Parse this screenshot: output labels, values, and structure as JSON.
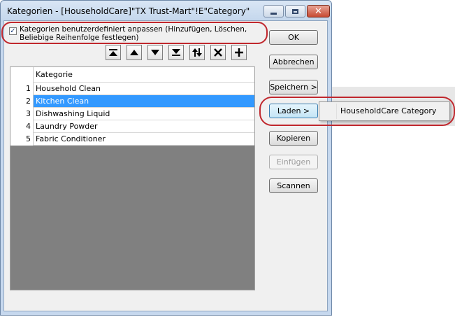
{
  "window": {
    "title": "Kategorien - [HouseholdCare]\"TX Trust-Mart\"!E\"Category\""
  },
  "customize_checkbox": {
    "checked": true,
    "label": "Kategorien benutzerdefiniert anpassen (Hinzufügen, Löschen, Beliebige Reihenfolge festlegen)"
  },
  "toolbar": [
    {
      "icon": "move-to-top-icon"
    },
    {
      "icon": "move-up-icon"
    },
    {
      "icon": "move-down-icon"
    },
    {
      "icon": "move-to-bottom-icon"
    },
    {
      "icon": "sort-icon"
    },
    {
      "icon": "delete-icon"
    },
    {
      "icon": "add-icon"
    }
  ],
  "grid": {
    "header": "Kategorie",
    "rows": [
      {
        "num": "1",
        "label": "Household Clean"
      },
      {
        "num": "2",
        "label": "Kitchen Clean"
      },
      {
        "num": "3",
        "label": "Dishwashing Liquid"
      },
      {
        "num": "4",
        "label": "Laundry Powder"
      },
      {
        "num": "5",
        "label": "Fabric Conditioner"
      }
    ],
    "selected_index": 1
  },
  "buttons": {
    "ok": "OK",
    "cancel": "Abbrechen",
    "save": "Speichern >",
    "load": "Laden >",
    "copy": "Kopieren",
    "paste": "Einfügen",
    "scan": "Scannen"
  },
  "load_menu": {
    "items": [
      "HouseholdCare Category"
    ]
  },
  "colors": {
    "selection": "#3399ff",
    "highlight_annotation": "#c0272d"
  }
}
